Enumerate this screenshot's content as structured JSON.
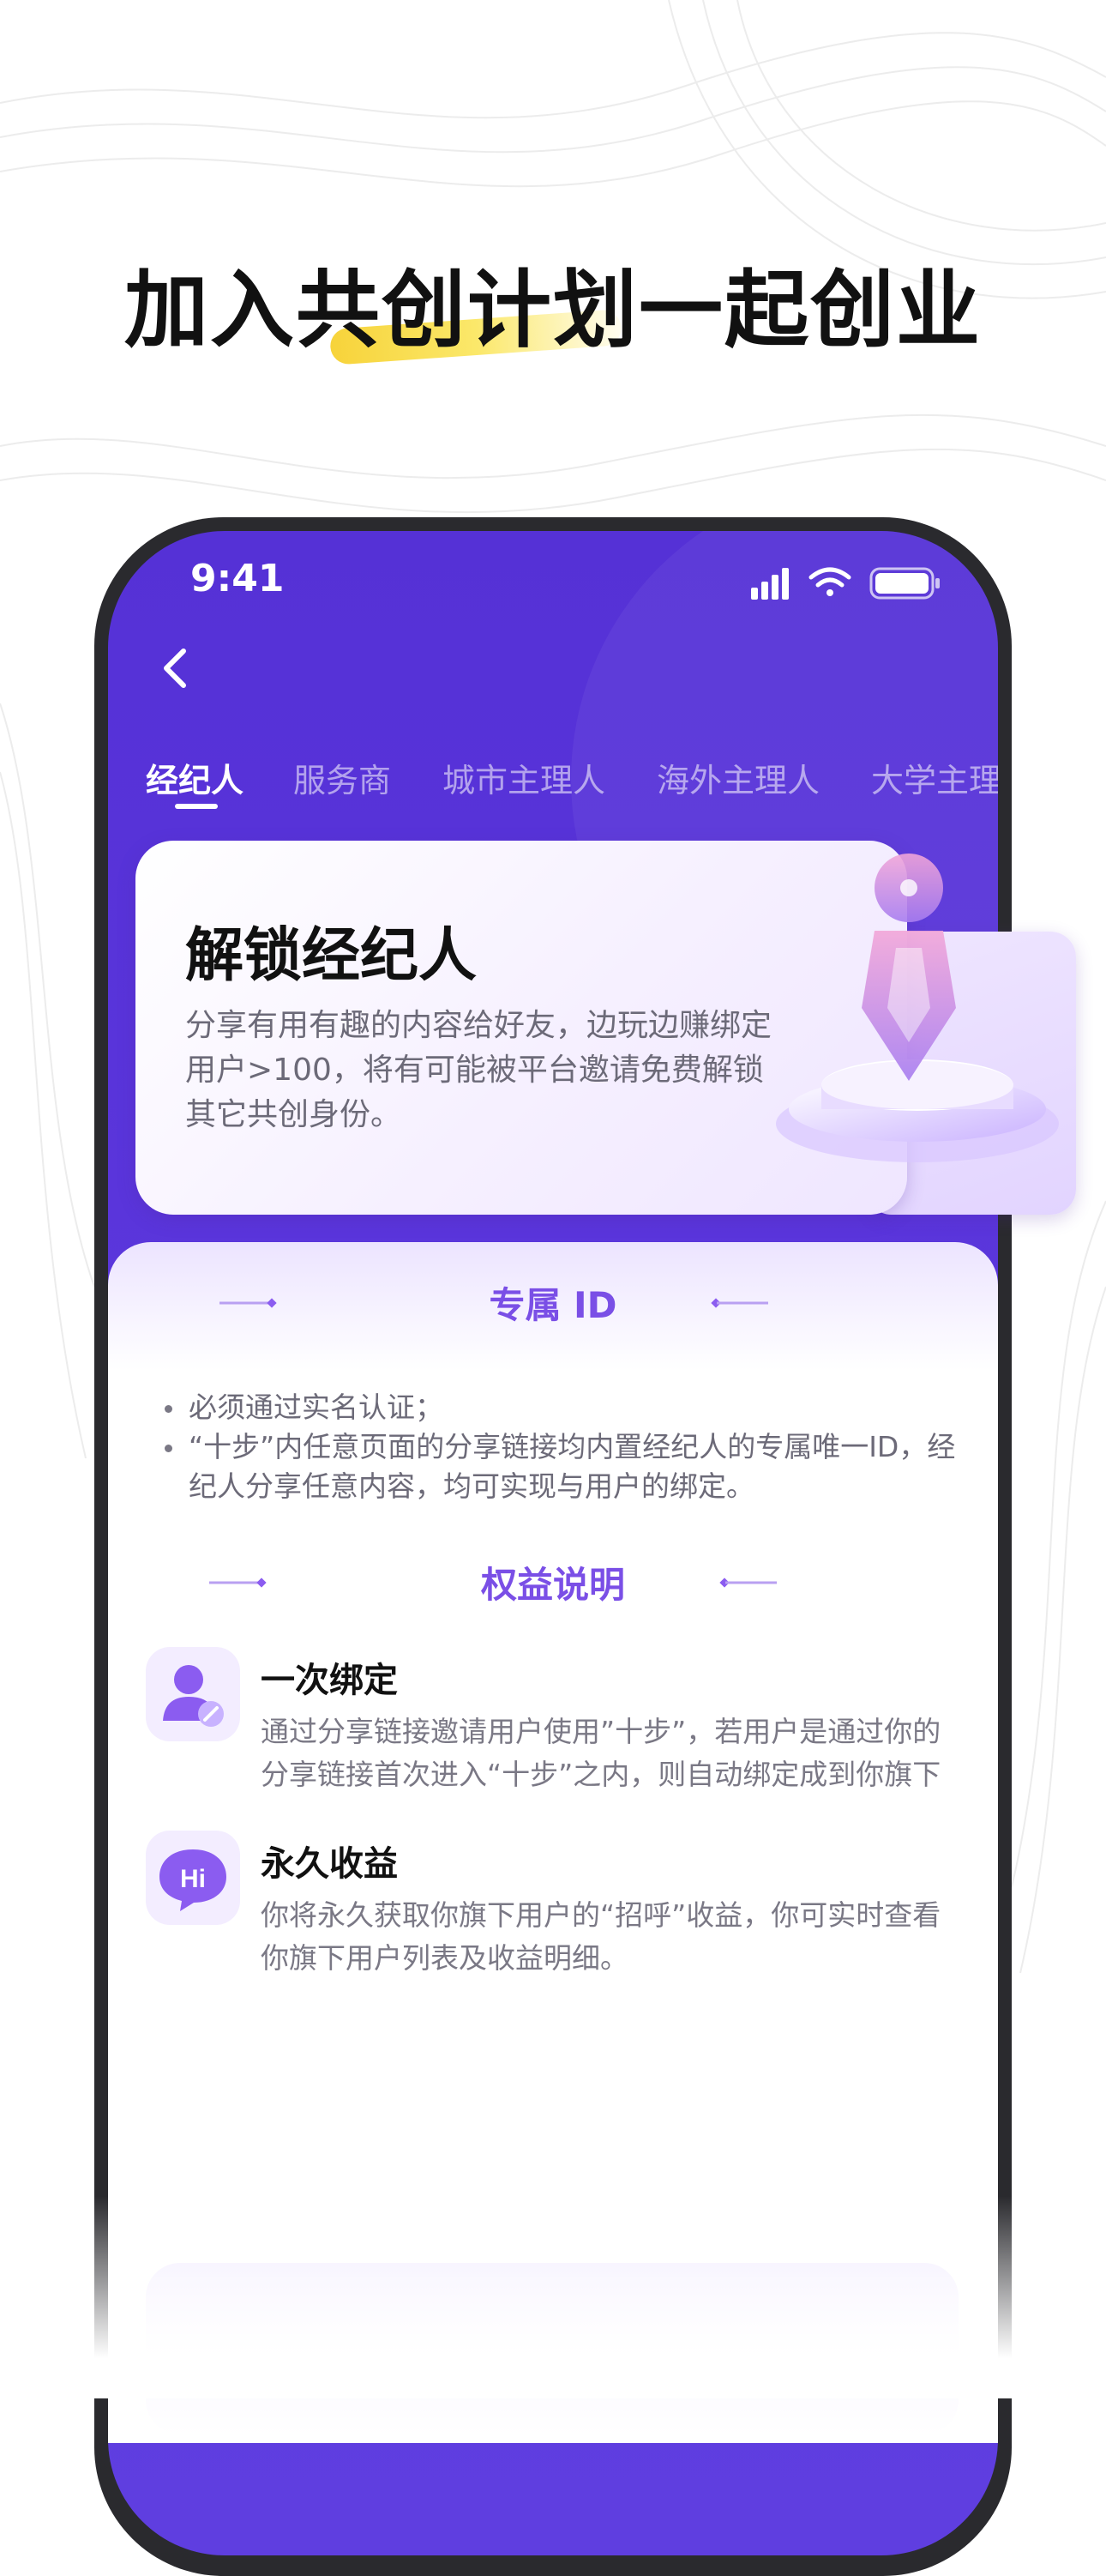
{
  "poster": {
    "headline": "加入共创计划一起创业"
  },
  "status_bar": {
    "time": "9:41"
  },
  "tabs": [
    {
      "label": "经纪人",
      "active": true
    },
    {
      "label": "服务商",
      "active": false
    },
    {
      "label": "城市主理人",
      "active": false
    },
    {
      "label": "海外主理人",
      "active": false
    },
    {
      "label": "大学主理",
      "active": false
    }
  ],
  "unlock_card": {
    "title": "解锁经纪人",
    "description": "分享有用有趣的内容给好友，边玩边赚绑定用户>100，将有可能被平台邀请免费解锁其它共创身份。"
  },
  "exclusive_id": {
    "heading": "专属 ID",
    "bullets": [
      "必须通过实名认证；",
      "“十步”内任意页面的分享链接均内置经纪人的专属唯一ID，经纪人分享任意内容，均可实现与用户的绑定。"
    ]
  },
  "benefits": {
    "heading": "权益说明",
    "items": [
      {
        "icon": "user-link-icon",
        "title": "一次绑定",
        "description": "通过分享链接邀请用户使用”十步”，若用户是通过你的分享链接首次进入“十步”之内，则自动绑定成到你旗下"
      },
      {
        "icon": "hi-chat-icon",
        "title": "永久收益",
        "description": "你将永久获取你旗下用户的“招呼”收益，你可实时查看你旗下用户列表及收益明细。"
      }
    ]
  },
  "colors": {
    "primary_purple": "#5531d6",
    "accent_purple": "#7a4fe6",
    "highlight_yellow": "#f7d33a"
  }
}
